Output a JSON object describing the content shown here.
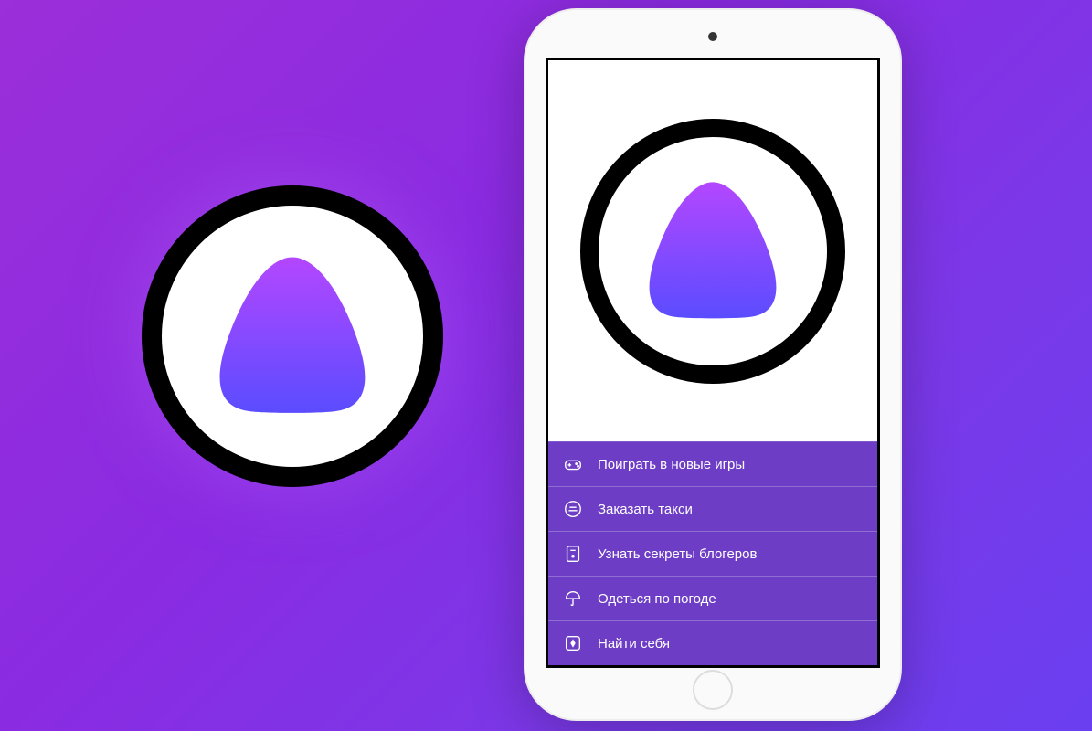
{
  "menu": {
    "items": [
      {
        "icon": "gamepad-icon",
        "label": "Поиграть в новые игры"
      },
      {
        "icon": "taxi-icon",
        "label": "Заказать такси"
      },
      {
        "icon": "book-icon",
        "label": "Узнать секреты блогеров"
      },
      {
        "icon": "umbrella-icon",
        "label": "Одеться по погоде"
      },
      {
        "icon": "compass-icon",
        "label": "Найти себя"
      }
    ]
  },
  "colors": {
    "background_start": "#9b2fd9",
    "background_end": "#6a3ff0",
    "menu_background": "#6d3dc5",
    "logo_gradient_start": "#b347ff",
    "logo_gradient_end": "#5b4cff"
  }
}
